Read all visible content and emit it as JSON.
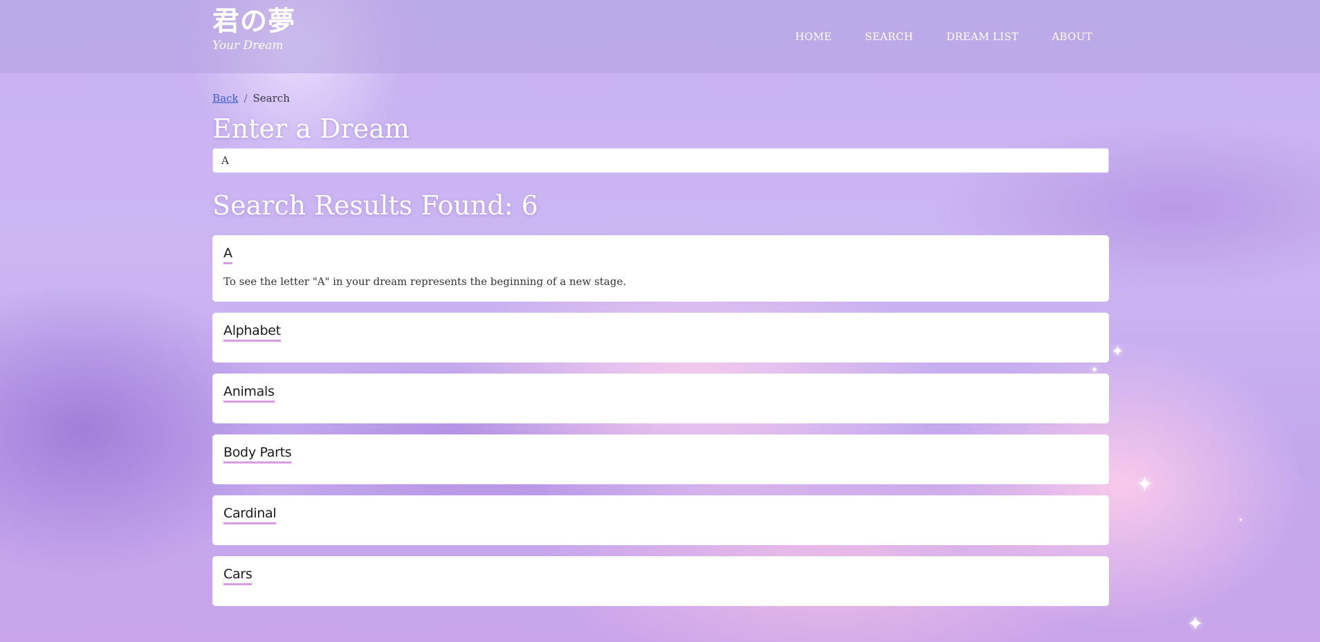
{
  "header": {
    "logo_jp": "君の夢",
    "logo_en": "Your Dream",
    "nav": [
      {
        "label": "HOME"
      },
      {
        "label": "SEARCH"
      },
      {
        "label": "DREAM LIST"
      },
      {
        "label": "ABOUT"
      }
    ]
  },
  "breadcrumb": {
    "back": "Back",
    "separator": "/",
    "current": "Search"
  },
  "search": {
    "heading": "Enter a Dream",
    "value": "A"
  },
  "results": {
    "heading": "Search Results Found: 6",
    "items": [
      {
        "title": "A",
        "description": "To see the letter \"A\" in your dream represents the beginning of a new stage."
      },
      {
        "title": "Alphabet"
      },
      {
        "title": "Animals"
      },
      {
        "title": "Body Parts"
      },
      {
        "title": "Cardinal"
      },
      {
        "title": "Cars"
      }
    ]
  },
  "colors": {
    "accent_underline": "#d99be3",
    "link": "#3b5bd6",
    "header_text": "#ffffff"
  }
}
